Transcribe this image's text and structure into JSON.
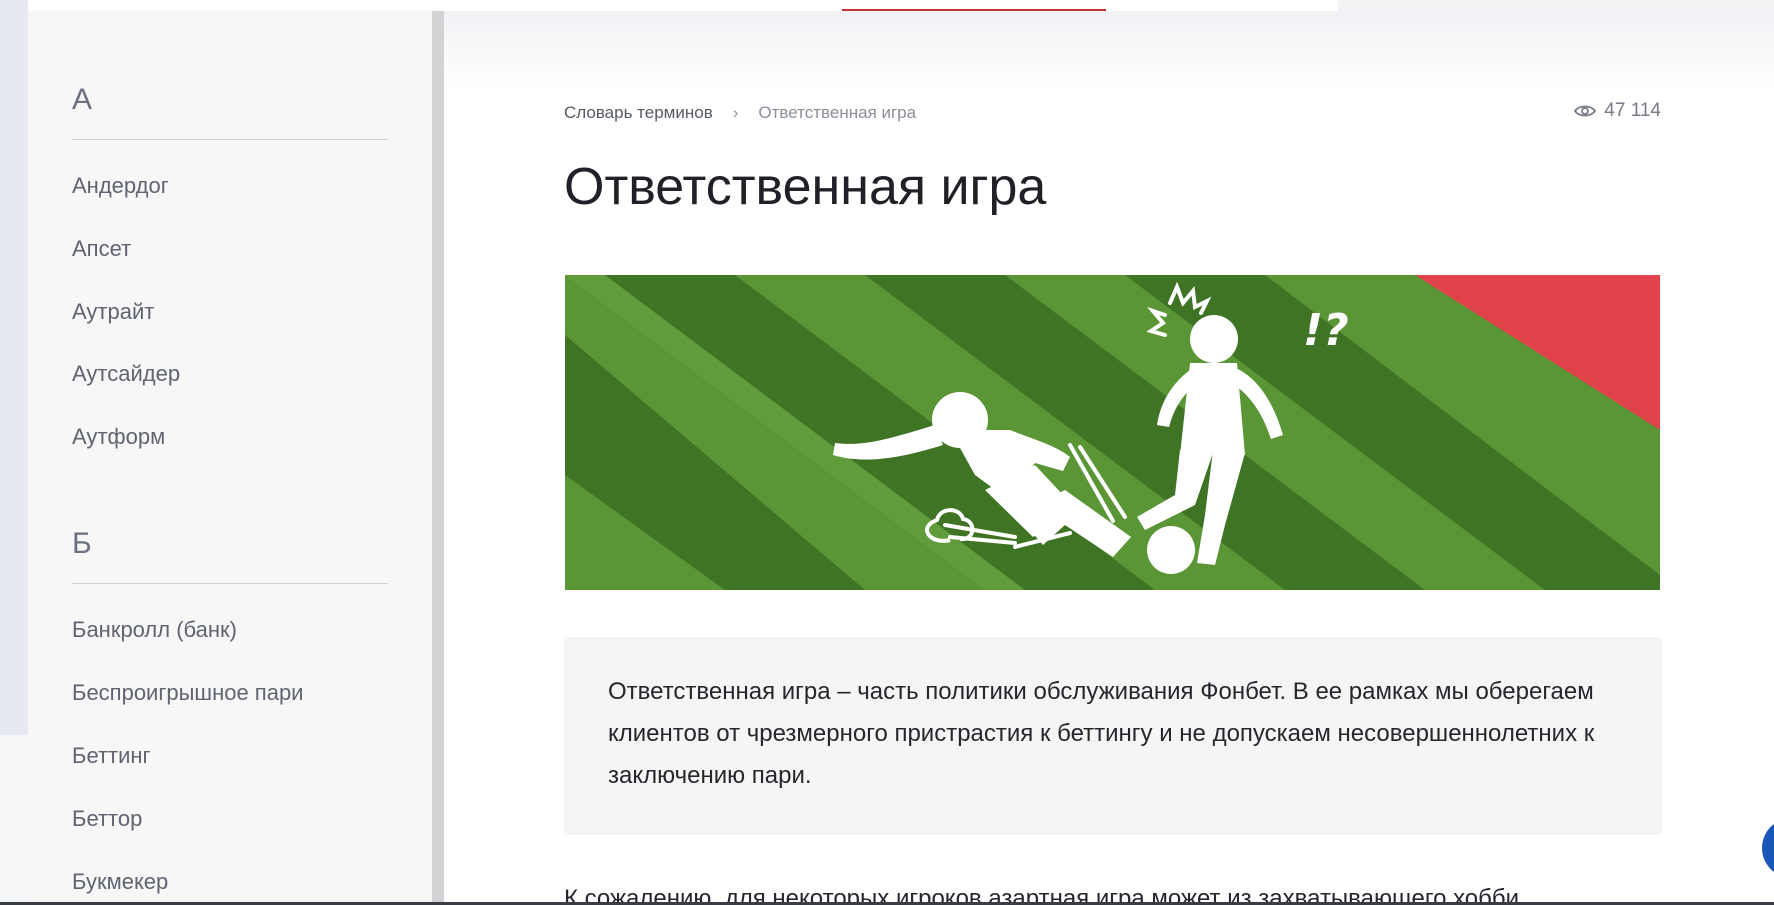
{
  "sidebar": {
    "sections": [
      {
        "letter": "А",
        "items": [
          "Андердог",
          "Апсет",
          "Аутрайт",
          "Аутсайдер",
          "Аутформ"
        ]
      },
      {
        "letter": "Б",
        "items": [
          "Банкролл (банк)",
          "Беспроигрышное пари",
          "Беттинг",
          "Беттор",
          "Букмекер"
        ]
      }
    ]
  },
  "breadcrumb": {
    "root": "Словарь терминов",
    "current": "Ответственная игра"
  },
  "views": {
    "count": "47 114",
    "icon": "eye-icon"
  },
  "article": {
    "title": "Ответственная игра",
    "hero_caption": "!?",
    "note": "Ответственная игра – часть политики обслуживания Фонбет. В ее рамках мы оберегаем клиентов от чрезмерного пристрастия к беттингу и не допускаем несовершеннолетних к заключению пари.",
    "body_start": "К сожалению, для некоторых игроков азартная игра может из захватывающего хобби"
  },
  "colors": {
    "accent_red": "#c8333a",
    "pitch_green": "#5a9636",
    "pitch_dark": "#3e7424",
    "corner_red": "#e0444a",
    "chat_blue": "#1a56b8"
  }
}
